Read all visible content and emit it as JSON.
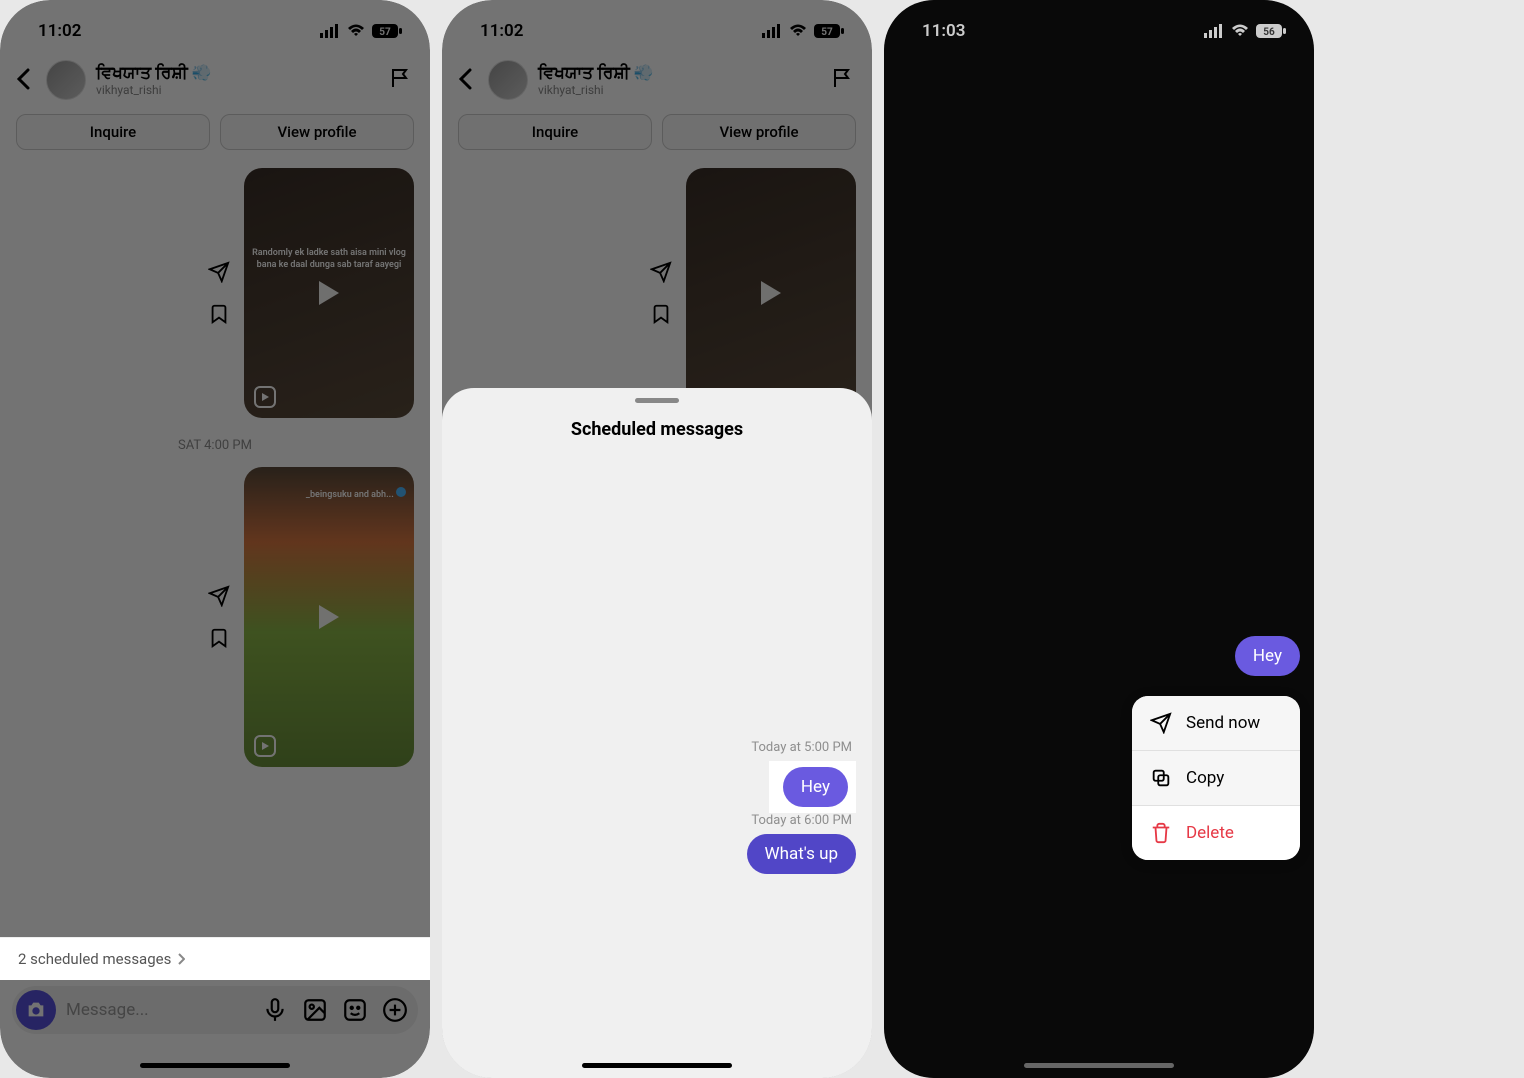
{
  "panel1": {
    "status": {
      "time": "11:02",
      "battery": "57"
    },
    "header": {
      "displayName": "ਵਿਖਯਾਤ ਰਿਸ਼ੀ",
      "emoji": "💨",
      "username": "vikhyat_rishi"
    },
    "buttons": {
      "inquire": "Inquire",
      "viewProfile": "View profile"
    },
    "reel1": {
      "caption": "Randomly ek ladke sath aisa mini vlog bana ke daal dunga sab taraf aayegi"
    },
    "timestamp": "SAT 4:00 PM",
    "reel2": {
      "caption": "_beingsuku and abh..."
    },
    "scheduledBanner": "2 scheduled messages",
    "input": {
      "placeholder": "Message..."
    }
  },
  "panel2": {
    "status": {
      "time": "11:02",
      "battery": "57"
    },
    "header": {
      "displayName": "ਵਿਖਯਾਤ ਰਿਸ਼ੀ",
      "username": "vikhyat_rishi"
    },
    "buttons": {
      "inquire": "Inquire",
      "viewProfile": "View profile"
    },
    "sheet": {
      "title": "Scheduled messages",
      "items": [
        {
          "time": "Today at 5:00 PM",
          "text": "Hey"
        },
        {
          "time": "Today at 6:00 PM",
          "text": "What's up"
        }
      ]
    }
  },
  "panel3": {
    "status": {
      "time": "11:03",
      "battery": "56"
    },
    "selectedMessage": "Hey",
    "menu": {
      "sendNow": "Send now",
      "copy": "Copy",
      "delete": "Delete"
    }
  },
  "icons": {
    "signal": "▮▮▮▮",
    "wifi": "wifi",
    "battery": "battery"
  }
}
